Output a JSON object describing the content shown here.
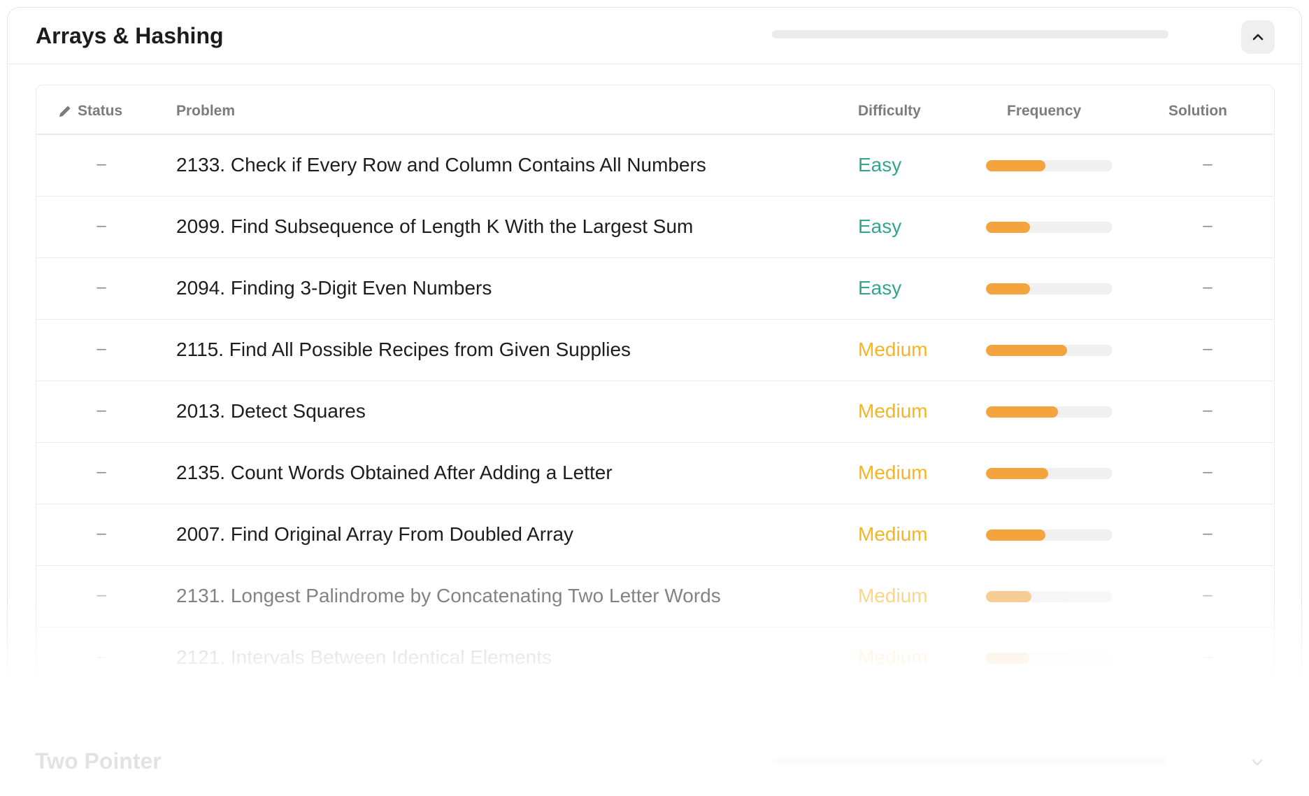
{
  "section": {
    "title": "Arrays & Hashing",
    "progress": 0,
    "toggle_icon": "chevron-up-icon"
  },
  "table": {
    "columns": {
      "status": "Status",
      "problem": "Problem",
      "difficulty": "Difficulty",
      "frequency": "Frequency",
      "solution": "Solution"
    },
    "rows": [
      {
        "status": "–",
        "problem": "2133. Check if Every Row and Column Contains All Numbers",
        "difficulty": "Easy",
        "frequency": 0.47,
        "solution": "–"
      },
      {
        "status": "–",
        "problem": "2099. Find Subsequence of Length K With the Largest Sum",
        "difficulty": "Easy",
        "frequency": 0.35,
        "solution": "–"
      },
      {
        "status": "–",
        "problem": "2094. Finding 3-Digit Even Numbers",
        "difficulty": "Easy",
        "frequency": 0.35,
        "solution": "–"
      },
      {
        "status": "–",
        "problem": "2115. Find All Possible Recipes from Given Supplies",
        "difficulty": "Medium",
        "frequency": 0.64,
        "solution": "–"
      },
      {
        "status": "–",
        "problem": "2013. Detect Squares",
        "difficulty": "Medium",
        "frequency": 0.57,
        "solution": "–"
      },
      {
        "status": "–",
        "problem": "2135. Count Words Obtained After Adding a Letter",
        "difficulty": "Medium",
        "frequency": 0.49,
        "solution": "–"
      },
      {
        "status": "–",
        "problem": "2007. Find Original Array From Doubled Array",
        "difficulty": "Medium",
        "frequency": 0.47,
        "solution": "–"
      },
      {
        "status": "–",
        "problem": "2131. Longest Palindrome by Concatenating Two Letter Words",
        "difficulty": "Medium",
        "frequency": 0.36,
        "solution": "–"
      },
      {
        "status": "–",
        "problem": "2121. Intervals Between Identical Elements",
        "difficulty": "Medium",
        "frequency": 0.34,
        "solution": "–"
      }
    ]
  },
  "next_section": {
    "title": "Two Pointer",
    "toggle_icon": "chevron-down-icon"
  },
  "colors": {
    "easy": "#33a68e",
    "medium": "#f5b523",
    "frequency_bar": "#f3a43f"
  }
}
